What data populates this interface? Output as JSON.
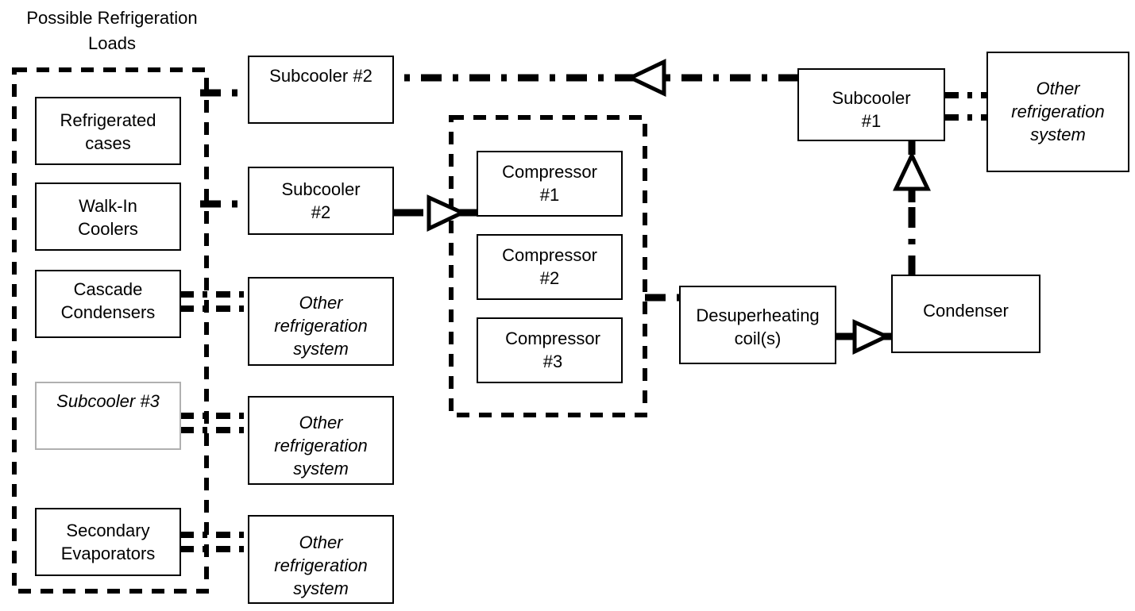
{
  "diagram": {
    "title": "Possible Refrigeration Loads",
    "title_line1": "Possible Refrigeration",
    "title_line2": "Loads",
    "accent_color": "#000000",
    "background_color": "#ffffff",
    "light_border_color": "#b0b0b0"
  },
  "loads_group": {
    "label": "Possible Refrigeration Loads",
    "boxes": [
      {
        "id": "refrigerated-cases",
        "line1": "Refrigerated",
        "line2": "cases",
        "italic": false
      },
      {
        "id": "walk-in-coolers",
        "line1": "Walk-In",
        "line2": "Coolers",
        "italic": false
      },
      {
        "id": "cascade-condensers",
        "line1": "Cascade",
        "line2": "Condensers",
        "italic": false
      },
      {
        "id": "subcooler-3",
        "line1": "Subcooler #3",
        "line2": "",
        "italic": true
      },
      {
        "id": "secondary-evaporators",
        "line1": "Secondary",
        "line2": "Evaporators",
        "italic": false
      }
    ]
  },
  "middle_column": {
    "boxes": [
      {
        "id": "subcooler-2-upper",
        "line1": "Subcooler #2",
        "line2": "",
        "line3": "",
        "italic": false
      },
      {
        "id": "subcooler-2-lower",
        "line1": "Subcooler",
        "line2": "#2",
        "line3": "",
        "italic": false
      },
      {
        "id": "other-refrigeration-system-1",
        "line1": "Other",
        "line2": "refrigeration",
        "line3": "system",
        "italic": true
      },
      {
        "id": "other-refrigeration-system-2",
        "line1": "Other",
        "line2": "refrigeration",
        "line3": "system",
        "italic": true
      },
      {
        "id": "other-refrigeration-system-3",
        "line1": "Other",
        "line2": "refrigeration",
        "line3": "system",
        "italic": true
      }
    ]
  },
  "compressor_rack": {
    "boxes": [
      {
        "id": "compressor-1",
        "line1": "Compressor",
        "line2": "#1"
      },
      {
        "id": "compressor-2",
        "line1": "Compressor",
        "line2": "#2"
      },
      {
        "id": "compressor-3",
        "line1": "Compressor",
        "line2": "#3"
      }
    ]
  },
  "right_side": {
    "subcooler_1": {
      "line1": "Subcooler",
      "line2": "#1"
    },
    "other_refrigeration_system": {
      "line1": "Other",
      "line2": "refrigeration",
      "line3": "system"
    },
    "desuperheating_coils": {
      "line1": "Desuperheating",
      "line2": "coil(s)"
    },
    "condenser": {
      "line1": "Condenser",
      "line2": ""
    }
  }
}
